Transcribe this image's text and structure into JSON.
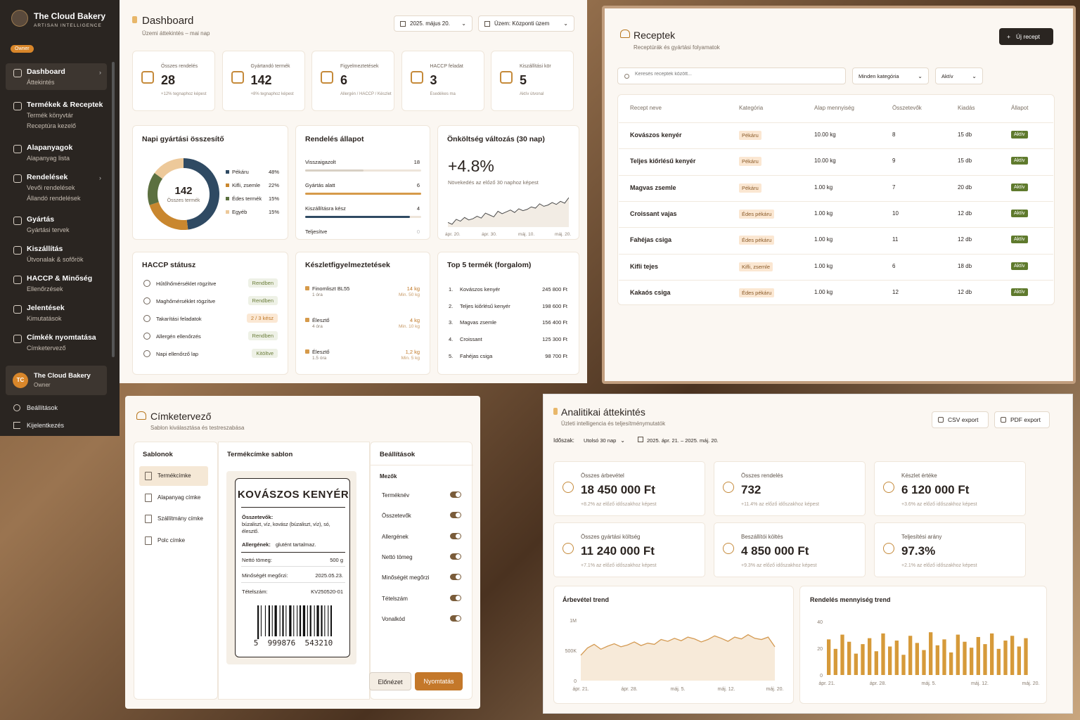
{
  "sidebar": {
    "app": "The Cloud Bakery",
    "tagline": "ARTISAN INTELLIGENCE",
    "role_badge": "Owner",
    "items": [
      {
        "title": "Dashboard",
        "subs": [
          "Áttekintés"
        ]
      },
      {
        "title": "Termékek & Receptek",
        "subs": [
          "Termék könyvtár",
          "Receptúra kezelő"
        ]
      },
      {
        "title": "Alapanyagok",
        "subs": [
          "Alapanyag lista"
        ]
      },
      {
        "title": "Rendelések",
        "subs": [
          "Vevői rendelések",
          "Állandó rendelések"
        ]
      },
      {
        "title": "Gyártás",
        "subs": [
          "Gyártási tervek"
        ]
      },
      {
        "title": "Kiszállítás",
        "subs": [
          "Útvonalak & sofőrök"
        ]
      },
      {
        "title": "HACCP & Minőség",
        "subs": [
          "Ellenőrzések"
        ]
      },
      {
        "title": "Jelentések",
        "subs": [
          "Kimutatások"
        ]
      },
      {
        "title": "Címkék nyomtatása",
        "subs": [
          "Címketervező"
        ]
      }
    ],
    "user": {
      "initials": "TC",
      "name": "The Cloud Bakery",
      "role": "Owner"
    },
    "settings": "Beállítások",
    "logout": "Kijelentkezés"
  },
  "dashboard": {
    "title": "Dashboard",
    "subtitle": "Üzemi áttekintés – mai nap",
    "date": "2025. május 20.",
    "plant": "Üzem: Központi üzem",
    "kpis": [
      {
        "label": "Összes rendelés",
        "value": "28",
        "sub": "+12% tegnaphoz képest"
      },
      {
        "label": "Gyártandó termék",
        "value": "142",
        "sub": "+8% tegnaphoz képest"
      },
      {
        "label": "Figyelmeztetések",
        "value": "6",
        "sub": "Allergén / HACCP / Készlet"
      },
      {
        "label": "HACCP feladat",
        "value": "3",
        "sub": "Esedékes ma"
      },
      {
        "label": "Kiszállítási kör",
        "value": "5",
        "sub": "Aktív útvonal"
      }
    ],
    "production": {
      "title": "Napi gyártási összesítő",
      "total": "142",
      "total_label": "Összes termék",
      "legend": [
        {
          "name": "Pékáru",
          "pct": "48%",
          "value": 48,
          "color": "#2f4a63"
        },
        {
          "name": "Kifli, zsemle",
          "pct": "22%",
          "value": 22,
          "color": "#c9872f"
        },
        {
          "name": "Édes termék",
          "pct": "15%",
          "value": 15,
          "color": "#5c7040"
        },
        {
          "name": "Egyéb",
          "pct": "15%",
          "value": 15,
          "color": "#edc99a"
        }
      ]
    },
    "order_status": {
      "title": "Rendelés állapot",
      "rows": [
        {
          "label": "Visszaigazolt",
          "count": "18",
          "fill": 0.5,
          "color": "#d8d0c4"
        },
        {
          "label": "Gyártás alatt",
          "count": "6",
          "fill": 1.0,
          "color": "#d69a4a"
        },
        {
          "label": "Kiszállításra kész",
          "count": "4",
          "fill": 0.9,
          "color": "#2f4a63"
        },
        {
          "label": "Teljesítve",
          "count": "0",
          "fill": 0,
          "color": "#d8d0c4"
        }
      ]
    },
    "cost": {
      "title": "Önköltség változás (30 nap)",
      "value": "+4.8%",
      "desc": "Növekedés az előző 30 naphoz képest",
      "xticks": [
        "ápr. 20.",
        "ápr. 30.",
        "máj. 10.",
        "máj. 20."
      ],
      "series": [
        40,
        37,
        45,
        42,
        48,
        44,
        46,
        50,
        47,
        55,
        52,
        49,
        58,
        54,
        57,
        60,
        56,
        62,
        59,
        61,
        65,
        63,
        70,
        66,
        68,
        72,
        69,
        74,
        71,
        80
      ]
    },
    "haccp": {
      "title": "HACCP státusz",
      "rows": [
        {
          "label": "Hűtőhőmérséklet rögzítve",
          "status": "Rendben",
          "kind": "ok"
        },
        {
          "label": "Maghőmérséklet rögzítve",
          "status": "Rendben",
          "kind": "ok"
        },
        {
          "label": "Takarítási feladatok",
          "status": "2 / 3 kész",
          "kind": "warn"
        },
        {
          "label": "Allergén ellenőrzés",
          "status": "Rendben",
          "kind": "ok"
        },
        {
          "label": "Napi ellenőrző lap",
          "status": "Kitöltve",
          "kind": "ok"
        }
      ]
    },
    "stock": {
      "title": "Készletfigyelmeztetések",
      "rows": [
        {
          "name": "Finomliszt BL55",
          "note": "1 óra",
          "qty": "14 kg",
          "min": "Min. 50 kg"
        },
        {
          "name": "Élesztő",
          "note": "4 óra",
          "qty": "4 kg",
          "min": "Min. 10 kg"
        },
        {
          "name": "Élesztő",
          "note": "1.5 óra",
          "qty": "1,2 kg",
          "min": "Min. 5 kg"
        }
      ]
    },
    "top5": {
      "title": "Top 5 termék (forgalom)",
      "rows": [
        {
          "n": "1.",
          "name": "Kovászos kenyér",
          "val": "245 800 Ft"
        },
        {
          "n": "2.",
          "name": "Teljes kiőrlésű kenyér",
          "val": "198 600 Ft"
        },
        {
          "n": "3.",
          "name": "Magvas zsemle",
          "val": "156 400 Ft"
        },
        {
          "n": "4.",
          "name": "Croissant",
          "val": "125 300 Ft"
        },
        {
          "n": "5.",
          "name": "Fahéjas csiga",
          "val": "98 700 Ft"
        }
      ]
    }
  },
  "recipes": {
    "title": "Receptek",
    "subtitle": "Receptúrák és gyártási folyamatok",
    "new_button": "Új recept",
    "search_placeholder": "Keresés receptek között...",
    "category": "Minden kategória",
    "status_filter": "Aktív",
    "columns": [
      "Recept neve",
      "Kategória",
      "Alap mennyiség",
      "Összetevők",
      "Kiadás",
      "Állapot"
    ],
    "rows": [
      {
        "name": "Kovászos kenyér",
        "cat": "Pékáru",
        "qty": "10.00 kg",
        "ing": "8",
        "yield": "15 db",
        "status": "Aktív"
      },
      {
        "name": "Teljes kiőrlésű kenyér",
        "cat": "Pékáru",
        "qty": "10.00 kg",
        "ing": "9",
        "yield": "15 db",
        "status": "Aktív"
      },
      {
        "name": "Magvas zsemle",
        "cat": "Pékáru",
        "qty": "1.00 kg",
        "ing": "7",
        "yield": "20 db",
        "status": "Aktív"
      },
      {
        "name": "Croissant vajas",
        "cat": "Édes pékáru",
        "qty": "1.00 kg",
        "ing": "10",
        "yield": "12 db",
        "status": "Aktív"
      },
      {
        "name": "Fahéjas csiga",
        "cat": "Édes pékáru",
        "qty": "1.00 kg",
        "ing": "11",
        "yield": "12 db",
        "status": "Aktív"
      },
      {
        "name": "Kifli tejes",
        "cat": "Kifli, zsemle",
        "qty": "1.00 kg",
        "ing": "6",
        "yield": "18 db",
        "status": "Aktív"
      },
      {
        "name": "Kakaós csiga",
        "cat": "Édes pékáru",
        "qty": "1.00 kg",
        "ing": "12",
        "yield": "12 db",
        "status": "Aktív"
      }
    ]
  },
  "label": {
    "title": "Címketervező",
    "subtitle": "Sablon kiválasztása és testreszabása",
    "templates_title": "Sablonok",
    "templates": [
      "Termékcímke",
      "Alapanyag címke",
      "Szállítmány címke",
      "Polc címke"
    ],
    "preview_title": "Termékcímke sablon",
    "settings_title": "Beállítások",
    "fields_title": "Mezők",
    "fields": [
      "Terméknév",
      "Összetevők",
      "Allergének",
      "Nettó tömeg",
      "Minőségét megőrzi",
      "Tételszám",
      "Vonalkód"
    ],
    "preview": {
      "product": "KOVÁSZOS KENYÉR",
      "ing_label": "Összetevők:",
      "ing_text": "búzaliszt, víz, kovász (búzaliszt, víz), só, élesztő.",
      "allergen_label": "Allergének:",
      "allergen_text": "glutént tartalmaz.",
      "net_label": "Nettó tömeg:",
      "net": "500 g",
      "bb_label": "Minőségét megőrzi:",
      "bb": "2025.05.23.",
      "lot_label": "Tételszám:",
      "lot": "KV250520-01",
      "barcode": "5  999876  543210"
    },
    "preview_button": "Előnézet",
    "print_button": "Nyomtatás"
  },
  "analytics": {
    "title": "Analitikai áttekintés",
    "subtitle": "Üzleti intelligencia és teljesítménymutatók",
    "csv": "CSV export",
    "pdf": "PDF export",
    "period_label": "Időszak:",
    "period": "Utolsó 30 nap",
    "range": "2025. ápr. 21. – 2025. máj. 20.",
    "kpis": [
      {
        "label": "Összes árbevétel",
        "value": "18 450 000 Ft",
        "sub": "+8.2% az előző időszakhoz képest"
      },
      {
        "label": "Összes rendelés",
        "value": "732",
        "sub": "+11.4% az előző időszakhoz képest"
      },
      {
        "label": "Készlet értéke",
        "value": "6 120 000 Ft",
        "sub": "+3.6% az előző időszakhoz képest"
      },
      {
        "label": "Összes gyártási költség",
        "value": "11 240 000 Ft",
        "sub": "+7.1% az előző időszakhoz képest"
      },
      {
        "label": "Beszállítói költés",
        "value": "4 850 000 Ft",
        "sub": "+9.3% az előző időszakhoz képest"
      },
      {
        "label": "Teljesítési arány",
        "value": "97.3%",
        "sub": "+2.1% az előző időszakhoz képest"
      }
    ]
  },
  "chart_data": [
    {
      "type": "area",
      "title": "Árbevétel trend",
      "x": [
        "ápr. 21.",
        "ápr. 28.",
        "máj. 5.",
        "máj. 12.",
        "máj. 20."
      ],
      "yticks": [
        "1M",
        "500K",
        "0"
      ],
      "ylim": [
        0,
        1000000
      ],
      "values": [
        420000,
        540000,
        600000,
        520000,
        570000,
        610000,
        560000,
        590000,
        640000,
        580000,
        620000,
        600000,
        680000,
        650000,
        700000,
        660000,
        720000,
        690000,
        640000,
        680000,
        740000,
        700000,
        650000,
        720000,
        690000,
        760000,
        700000,
        680000,
        720000,
        560000
      ]
    },
    {
      "type": "bar",
      "title": "Rendelés mennyiség trend",
      "x": [
        "ápr. 21.",
        "ápr. 28.",
        "máj. 5.",
        "máj. 12.",
        "máj. 20."
      ],
      "yticks": [
        "40",
        "20",
        "0"
      ],
      "ylim": [
        0,
        45
      ],
      "values": [
        30,
        22,
        34,
        28,
        18,
        26,
        31,
        20,
        35,
        24,
        29,
        17,
        33,
        27,
        21,
        36,
        25,
        30,
        19,
        34,
        28,
        23,
        32,
        26,
        35,
        22,
        29,
        33,
        24,
        31
      ]
    }
  ]
}
